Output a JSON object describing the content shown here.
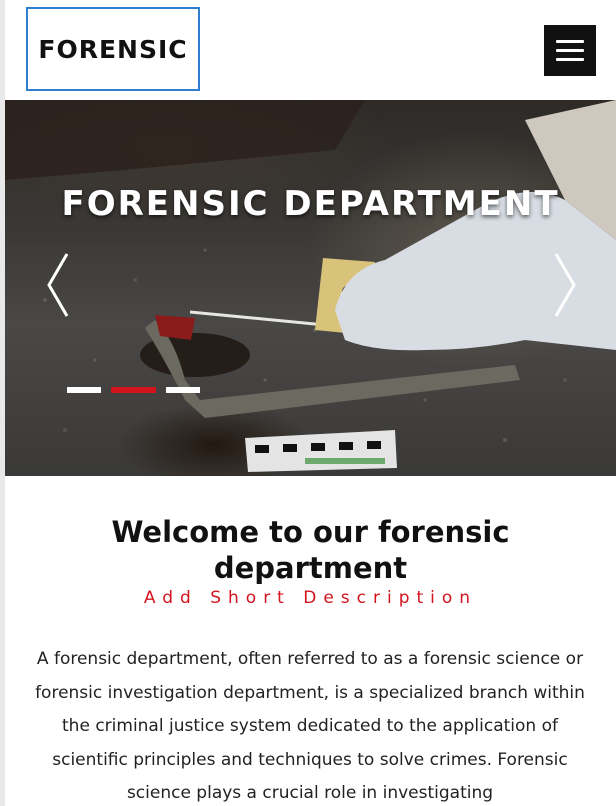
{
  "header": {
    "logo_text": "FORENSIC",
    "menu_icon": "hamburger-menu-icon"
  },
  "hero": {
    "title": "FORENSIC DEPARTMENT",
    "prev_icon": "chevron-left-icon",
    "next_icon": "chevron-right-icon",
    "slide_count": 3,
    "active_slide": 2,
    "indicator_active_color": "#d4141c"
  },
  "intro": {
    "heading_line1": "Welcome to our forensic",
    "heading_line2": "department",
    "subtitle": "Add Short Description",
    "body": "A forensic department, often referred to as a forensic science or forensic investigation department, is a specialized branch within the criminal justice system dedicated to the application of scientific principles and techniques to solve crimes. Forensic science plays a crucial role in investigating"
  },
  "colors": {
    "logo_border": "#2f7fd1",
    "accent": "#d4141c",
    "menu_bg": "#111111"
  }
}
